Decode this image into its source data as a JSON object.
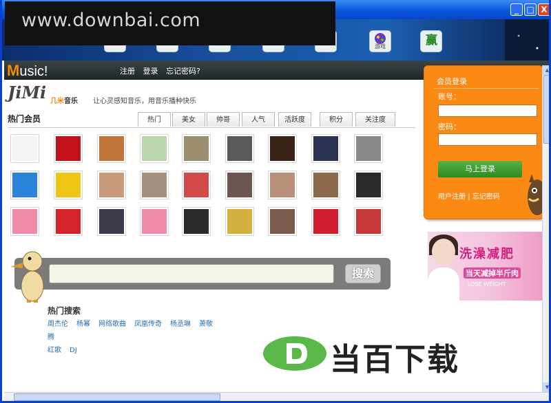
{
  "watermark": {
    "text": "www.downbai.com"
  },
  "window_controls": {
    "minimize": "_",
    "maximize": "□",
    "close": "X"
  },
  "top_icons": [
    {
      "name": "game-icon",
      "label": "游戏"
    },
    {
      "name": "win-icon",
      "label": "赢"
    }
  ],
  "header": {
    "logo_m": "M",
    "logo_rest": "usic!",
    "links": [
      "注册",
      "登录",
      "忘记密码?"
    ]
  },
  "brand": {
    "logo_text": "JiMi",
    "logo_cn_1": "几米",
    "logo_cn_2": "音乐",
    "slogan": "让心灵感知音乐，用音乐播种快乐"
  },
  "members": {
    "title": "热门会员",
    "tabs": [
      "热门",
      "美女",
      "帅哥",
      "人气",
      "活跃度",
      "积分",
      "关注度"
    ],
    "active_tab": "热门",
    "rows": [
      [
        {
          "color": "#f4f4f4"
        },
        {
          "color": "#c1121c"
        },
        {
          "color": "#c2753a"
        },
        {
          "color": "#bcd7b0"
        },
        {
          "color": "#9a8e6e"
        },
        {
          "color": "#5a5a5a"
        },
        {
          "color": "#3a2418"
        },
        {
          "color": "#2b3350"
        },
        {
          "color": "#8a8a8a"
        }
      ],
      [
        {
          "color": "#2c84d8"
        },
        {
          "color": "#f1c515"
        },
        {
          "color": "#c89b7a"
        },
        {
          "color": "#a89080"
        },
        {
          "color": "#d24a4a"
        },
        {
          "color": "#6e5650"
        },
        {
          "color": "#b8907a"
        },
        {
          "color": "#8a6a4a"
        },
        {
          "color": "#2a2a2a"
        }
      ],
      [
        {
          "color": "#f08ca8"
        },
        {
          "color": "#d4242a"
        },
        {
          "color": "#3a3a4a"
        },
        {
          "color": "#f08ca8"
        },
        {
          "color": "#2a2a2a"
        },
        {
          "color": "#d4b040"
        },
        {
          "color": "#7a5a4a"
        },
        {
          "color": "#d02030"
        },
        {
          "color": "#c4383a"
        }
      ]
    ]
  },
  "login": {
    "title": "会员登录",
    "account_label": "账号：",
    "password_label": "密码：",
    "submit": "马上登录",
    "register": "用户注册",
    "divider": "|",
    "forgot": "忘记密码"
  },
  "ad": {
    "headline": "洗澡减肥",
    "sub": "当天减掉半斤肉",
    "en": "LOSE WEIGHT"
  },
  "search": {
    "button": "搜索",
    "hot_title": "热门搜索",
    "hot_links": [
      "周杰伦",
      "杨幂",
      "网络歌曲",
      "凤凰传奇",
      "杨丞琳",
      "萧敬腾",
      "红歌",
      "DJ"
    ]
  },
  "download_logo": {
    "mark": "D",
    "text": "当百下载"
  },
  "colors": {
    "title_bar": "#0a57e0",
    "header_bg": "#2a3234",
    "accent_orange": "#fa8a14",
    "login_button": "#3a9a2c",
    "link_blue": "#2a6fb0"
  }
}
